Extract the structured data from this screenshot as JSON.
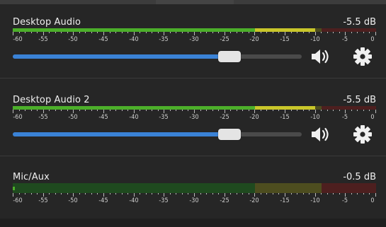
{
  "channels": [
    {
      "name": "Desktop Audio",
      "db": "-5.5 dB",
      "level_db": -10,
      "volume_fraction": 0.75,
      "has_controls": true
    },
    {
      "name": "Desktop Audio 2",
      "db": "-5.5 dB",
      "level_db": -10,
      "volume_fraction": 0.75,
      "has_controls": true
    },
    {
      "name": "Mic/Aux",
      "db": "-0.5 dB",
      "level_db": -60,
      "volume_fraction": null,
      "has_controls": false
    }
  ],
  "scale": {
    "min_db": -60,
    "max_db": 0,
    "labels": [
      "-60",
      "-55",
      "-50",
      "-45",
      "-40",
      "-35",
      "-30",
      "-25",
      "-20",
      "-15",
      "-10",
      "-5",
      "0"
    ],
    "yellow_from_db": -20,
    "red_from_db": -9
  },
  "icons": {
    "mute": "speaker-volume-icon",
    "settings": "gear-icon"
  },
  "colors": {
    "meter_green": "#4caf2a",
    "meter_yellow": "#c9c62a",
    "meter_red": "#d9302a",
    "slider_fill": "#3a82d6"
  }
}
